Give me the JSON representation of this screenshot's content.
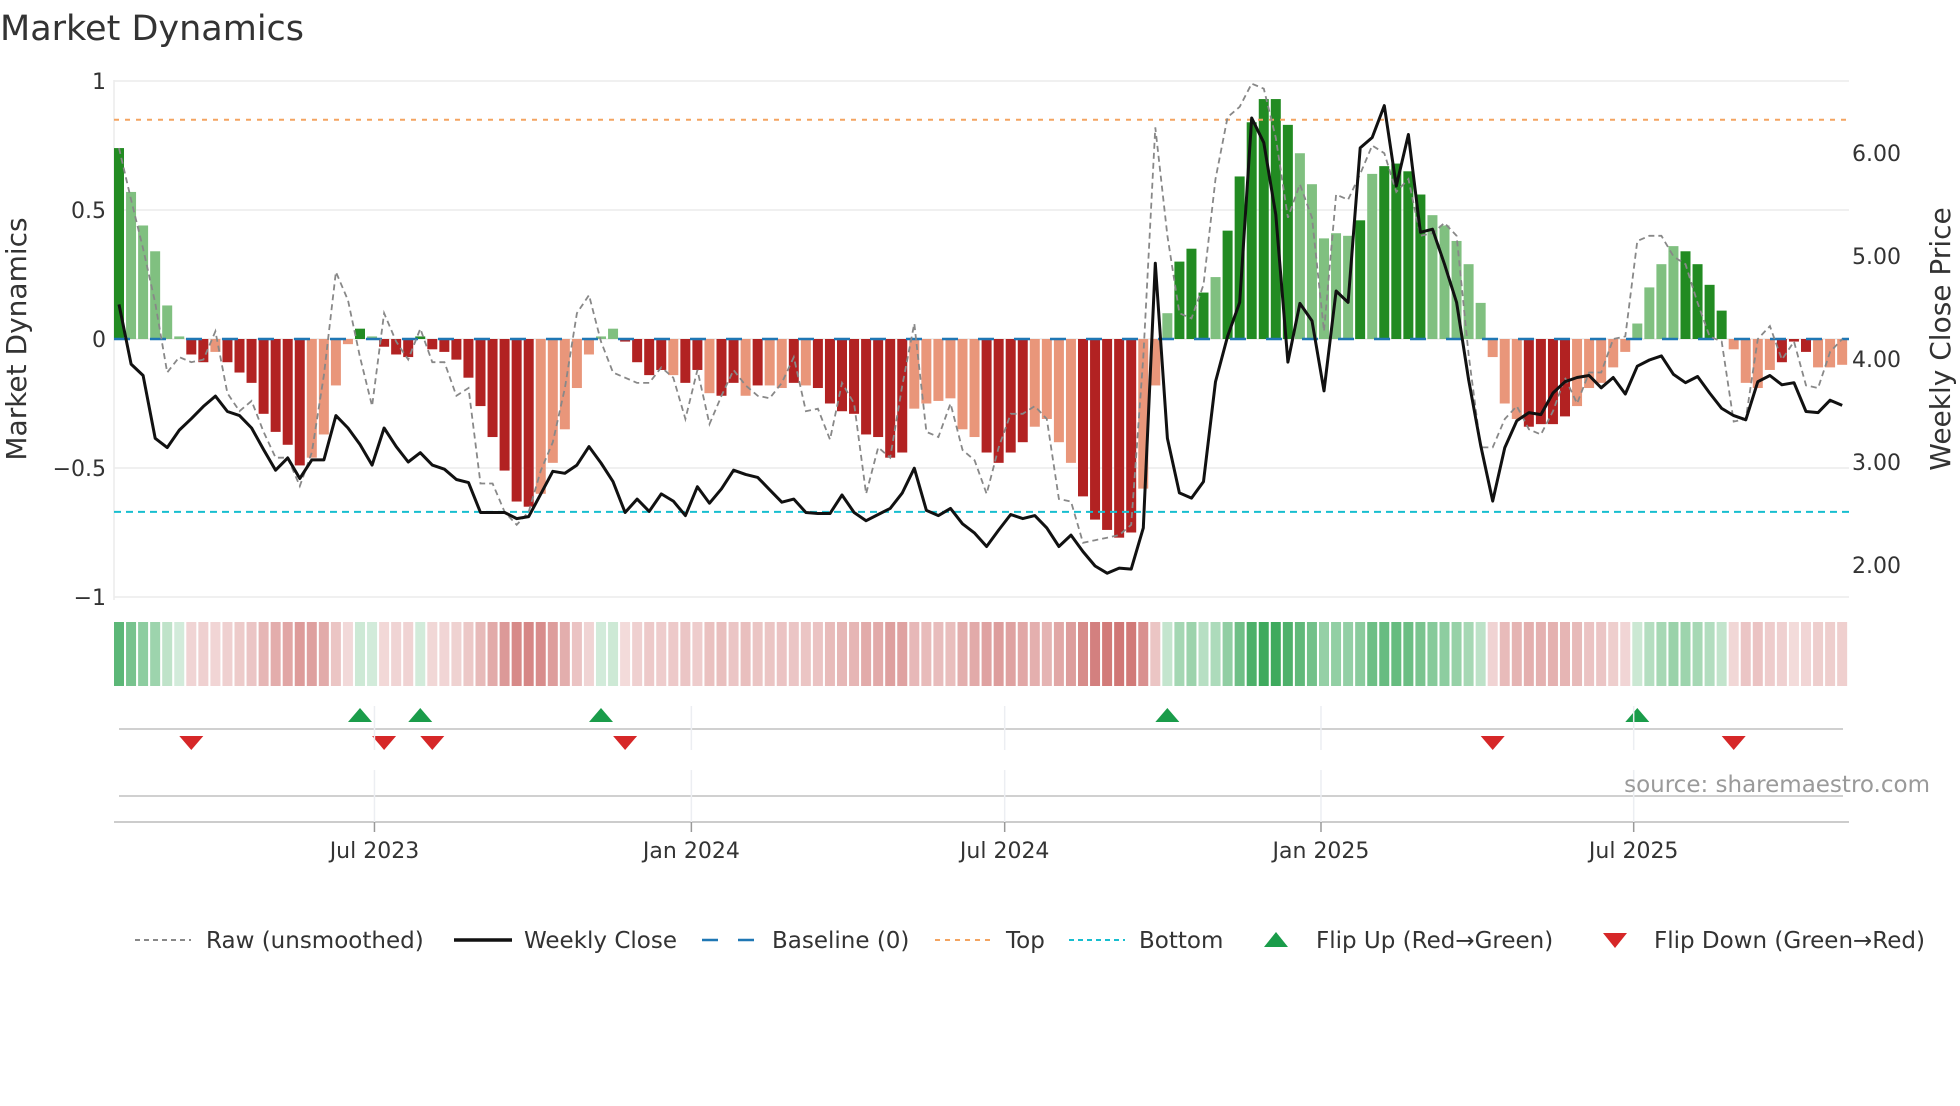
{
  "chart_data": {
    "type": "bar",
    "title": "Market Dynamics",
    "ylabel": "Market Dynamics",
    "y2label": "Weekly Close Price",
    "ylim": [
      -1,
      1
    ],
    "y2lim": [
      1.5,
      6.8
    ],
    "y_ticks": [
      {
        "v": 1,
        "label": "1"
      },
      {
        "v": 0.5,
        "label": "0.5"
      },
      {
        "v": 0,
        "label": "0"
      },
      {
        "v": -0.5,
        "label": "−0.5"
      },
      {
        "v": -1,
        "label": "−1"
      }
    ],
    "y2_ticks": [
      {
        "v": 6,
        "label": "6.00"
      },
      {
        "v": 5,
        "label": "5.00"
      },
      {
        "v": 4,
        "label": "4.00"
      },
      {
        "v": 3,
        "label": "3.00"
      },
      {
        "v": 2,
        "label": "2.00"
      }
    ],
    "x_ticks": [
      {
        "week": 21.2,
        "label": "Jul 2023"
      },
      {
        "week": 47.5,
        "label": "Jan 2024"
      },
      {
        "week": 73.5,
        "label": "Jul 2024"
      },
      {
        "week": 99.75,
        "label": "Jan 2025"
      },
      {
        "week": 125.7,
        "label": "Jul 2025"
      }
    ],
    "grid": true,
    "top_level": 0.85,
    "bottom_level": -0.67,
    "baseline": 0,
    "smoothed": [
      0.74,
      0.57,
      0.44,
      0.34,
      0.13,
      0.01,
      -0.06,
      -0.09,
      -0.05,
      -0.09,
      -0.13,
      -0.17,
      -0.29,
      -0.36,
      -0.41,
      -0.49,
      -0.46,
      -0.37,
      -0.18,
      -0.02,
      0.04,
      0.01,
      -0.03,
      -0.06,
      -0.07,
      0.01,
      -0.04,
      -0.05,
      -0.08,
      -0.15,
      -0.26,
      -0.38,
      -0.51,
      -0.63,
      -0.65,
      -0.6,
      -0.48,
      -0.35,
      -0.19,
      -0.06,
      0.01,
      0.04,
      -0.01,
      -0.09,
      -0.14,
      -0.12,
      -0.14,
      -0.17,
      -0.12,
      -0.21,
      -0.22,
      -0.17,
      -0.22,
      -0.18,
      -0.18,
      -0.19,
      -0.17,
      -0.18,
      -0.19,
      -0.25,
      -0.28,
      -0.29,
      -0.37,
      -0.38,
      -0.46,
      -0.44,
      -0.27,
      -0.25,
      -0.24,
      -0.23,
      -0.35,
      -0.38,
      -0.44,
      -0.48,
      -0.44,
      -0.4,
      -0.34,
      -0.31,
      -0.4,
      -0.48,
      -0.61,
      -0.7,
      -0.74,
      -0.77,
      -0.75,
      -0.58,
      -0.18,
      0.1,
      0.3,
      0.35,
      0.18,
      0.24,
      0.42,
      0.63,
      0.84,
      0.93,
      0.93,
      0.83,
      0.72,
      0.6,
      0.39,
      0.41,
      0.4,
      0.46,
      0.64,
      0.67,
      0.68,
      0.65,
      0.56,
      0.48,
      0.44,
      0.38,
      0.29,
      0.14,
      -0.07,
      -0.25,
      -0.31,
      -0.34,
      -0.33,
      -0.33,
      -0.3,
      -0.26,
      -0.19,
      -0.17,
      -0.11,
      -0.05,
      0.06,
      0.2,
      0.29,
      0.36,
      0.34,
      0.29,
      0.21,
      0.11,
      -0.04,
      -0.17,
      -0.19,
      -0.12,
      -0.09,
      -0.01,
      -0.05,
      -0.11,
      -0.11,
      -0.1
    ],
    "bar_intensity": "dlllllddldddddddlllldldddddddddddddlllllllddddlddlddldlldlddddddddllllllddddlllldddddllldddlddddddllllldlddddllllllllddddlllllllllddddlllldddllllddll",
    "raw": [
      0.74,
      0.54,
      0.35,
      0.14,
      -0.13,
      -0.07,
      -0.09,
      -0.08,
      0.03,
      -0.21,
      -0.28,
      -0.24,
      -0.36,
      -0.46,
      -0.46,
      -0.57,
      -0.44,
      -0.14,
      0.26,
      0.15,
      -0.07,
      -0.26,
      0.1,
      -0.01,
      -0.08,
      0.04,
      -0.09,
      -0.09,
      -0.22,
      -0.19,
      -0.56,
      -0.56,
      -0.67,
      -0.72,
      -0.67,
      -0.51,
      -0.4,
      -0.19,
      0.1,
      0.17,
      -0.01,
      -0.13,
      -0.15,
      -0.17,
      -0.17,
      -0.11,
      -0.15,
      -0.31,
      -0.12,
      -0.33,
      -0.22,
      -0.12,
      -0.18,
      -0.22,
      -0.23,
      -0.17,
      -0.07,
      -0.28,
      -0.27,
      -0.39,
      -0.17,
      -0.25,
      -0.6,
      -0.42,
      -0.46,
      -0.18,
      0.06,
      -0.36,
      -0.38,
      -0.25,
      -0.43,
      -0.47,
      -0.6,
      -0.42,
      -0.29,
      -0.29,
      -0.26,
      -0.31,
      -0.62,
      -0.63,
      -0.79,
      -0.78,
      -0.77,
      -0.76,
      -0.72,
      -0.07,
      0.82,
      0.4,
      0.1,
      0.08,
      0.21,
      0.62,
      0.86,
      0.9,
      0.99,
      0.97,
      0.78,
      0.47,
      0.6,
      0.47,
      0.03,
      0.56,
      0.54,
      0.64,
      0.75,
      0.72,
      0.57,
      0.62,
      0.4,
      0.41,
      0.45,
      0.4,
      -0.06,
      -0.42,
      -0.42,
      -0.31,
      -0.26,
      -0.35,
      -0.37,
      -0.28,
      -0.15,
      -0.25,
      -0.13,
      -0.13,
      0.0,
      0.01,
      0.38,
      0.4,
      0.4,
      0.32,
      0.29,
      0.14,
      0.01,
      -0.01,
      -0.32,
      -0.31,
      0.0,
      0.05,
      -0.08,
      -0.01,
      -0.18,
      -0.19,
      -0.05,
      0.0
    ],
    "weekly_close": [
      4.53,
      3.95,
      3.84,
      3.23,
      3.14,
      3.31,
      3.42,
      3.54,
      3.64,
      3.49,
      3.45,
      3.33,
      3.12,
      2.92,
      3.04,
      2.84,
      3.02,
      3.02,
      3.45,
      3.33,
      3.17,
      2.97,
      3.33,
      3.15,
      3.0,
      3.09,
      2.97,
      2.93,
      2.83,
      2.8,
      2.51,
      2.51,
      2.51,
      2.45,
      2.47,
      2.69,
      2.91,
      2.89,
      2.97,
      3.15,
      2.99,
      2.81,
      2.51,
      2.64,
      2.52,
      2.69,
      2.62,
      2.48,
      2.76,
      2.6,
      2.74,
      2.92,
      2.88,
      2.85,
      2.73,
      2.61,
      2.64,
      2.51,
      2.5,
      2.5,
      2.68,
      2.51,
      2.43,
      2.49,
      2.55,
      2.7,
      2.94,
      2.53,
      2.48,
      2.55,
      2.4,
      2.31,
      2.18,
      2.34,
      2.49,
      2.45,
      2.48,
      2.36,
      2.18,
      2.29,
      2.13,
      1.99,
      1.92,
      1.97,
      1.96,
      2.36,
      4.93,
      3.23,
      2.7,
      2.65,
      2.81,
      3.78,
      4.22,
      4.55,
      6.34,
      6.1,
      5.4,
      3.97,
      4.54,
      4.37,
      3.69,
      4.66,
      4.55,
      6.05,
      6.15,
      6.46,
      5.68,
      6.18,
      5.23,
      5.26,
      4.92,
      4.55,
      3.8,
      3.16,
      2.62,
      3.14,
      3.4,
      3.48,
      3.46,
      3.67,
      3.78,
      3.82,
      3.84,
      3.72,
      3.82,
      3.66,
      3.93,
      3.99,
      4.03,
      3.85,
      3.77,
      3.83,
      3.67,
      3.52,
      3.45,
      3.41,
      3.78,
      3.84,
      3.75,
      3.77,
      3.49,
      3.48,
      3.6,
      3.55
    ],
    "flip_up_weeks": [
      20,
      25,
      40,
      87,
      126
    ],
    "flip_down_weeks": [
      6,
      22,
      26,
      42,
      114,
      134
    ],
    "colors": {
      "pos_strong": "#228b22",
      "pos_weak": "#80c080",
      "neg_strong": "#b22222",
      "neg_weak": "#e9967a",
      "raw": "#888888",
      "close": "#111111",
      "baseline": "#1f77b4",
      "top": "#f4a460",
      "bottom": "#17becf",
      "flip_up": "#1a9c4a",
      "flip_down": "#d62728"
    },
    "source": "source: sharemaestro.com",
    "legend": [
      {
        "key": "raw",
        "label": "Raw (unsmoothed)"
      },
      {
        "key": "close",
        "label": "Weekly Close"
      },
      {
        "key": "baseline",
        "label": "Baseline (0)"
      },
      {
        "key": "top",
        "label": "Top"
      },
      {
        "key": "bottom",
        "label": "Bottom"
      },
      {
        "key": "flip_up",
        "label": "Flip Up (Red→Green)"
      },
      {
        "key": "flip_down",
        "label": "Flip Down (Green→Red)"
      }
    ]
  }
}
